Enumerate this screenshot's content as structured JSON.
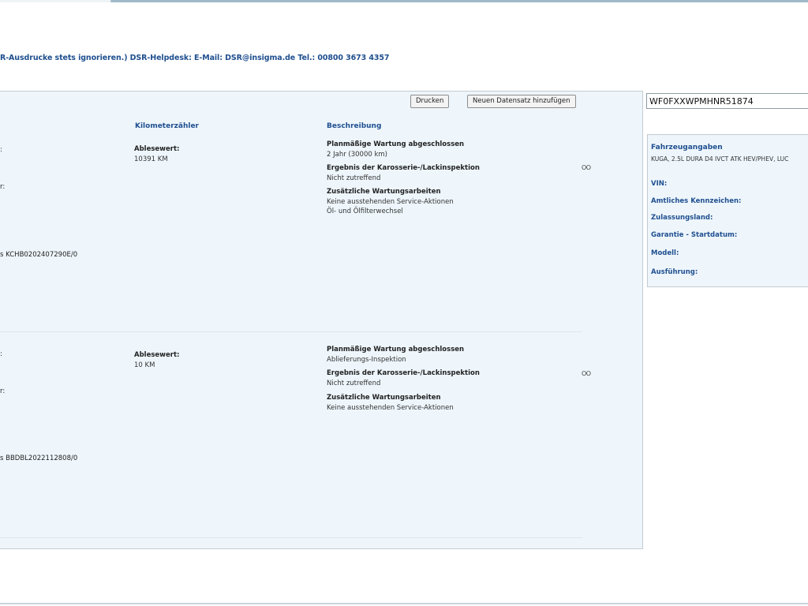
{
  "header": {
    "info_line": "R-Ausdrucke stets ignorieren.) DSR-Helpdesk: E-Mail: DSR@insigma.de Tel.: 00800 3673 4357"
  },
  "toolbar": {
    "print_label": "Drucken",
    "add_record_label": "Neuen Datensatz hinzufügen"
  },
  "columns": {
    "odometer": "Kilometerzähler",
    "description": "Beschreibung"
  },
  "records": [
    {
      "reading_label": "Ablesewert:",
      "reading_value": "10391 KM",
      "left_fragment_1": ":",
      "left_fragment_2": "r:",
      "left_fragment_ref": "s KCHB0202407290E/0",
      "service_title": "Planmäßige Wartung abgeschlossen",
      "service_value": "2 Jahr (30000 km)",
      "inspection_title": "Ergebnis der Karosserie-/Lackinspektion",
      "inspection_value": "Nicht zutreffend",
      "extra_title": "Zusätzliche Wartungsarbeiten",
      "extra_value_1": "Keine ausstehenden Service-Aktionen",
      "extra_value_2": "Öl- und Ölfilterwechsel",
      "icon_text": "OO"
    },
    {
      "reading_label": "Ablesewert:",
      "reading_value": "10 KM",
      "left_fragment_1": ":",
      "left_fragment_2": "r:",
      "left_fragment_ref": "s BBDBL2022112808/0",
      "service_title": "Planmäßige Wartung abgeschlossen",
      "service_value": "Ablieferungs-Inspektion",
      "inspection_title": "Ergebnis der Karosserie-/Lackinspektion",
      "inspection_value": "Nicht zutreffend",
      "extra_title": "Zusätzliche Wartungsarbeiten",
      "extra_value_1": "Keine ausstehenden Service-Aktionen",
      "icon_text": "OO"
    }
  ],
  "vin_search": {
    "value": "WF0FXXWPMHNR51874"
  },
  "vehicle": {
    "title": "Fahrzeugangaben",
    "description": "KUGA, 2.5L DURA D4 IVCT ATK HEV/PHEV, LUC",
    "vin_label": "VIN:",
    "plate_label": "Amtliches Kennzeichen:",
    "country_label": "Zulassungsland:",
    "warranty_label": "Garantie - Startdatum:",
    "model_label": "Modell:",
    "trim_label": "Ausführung:"
  }
}
